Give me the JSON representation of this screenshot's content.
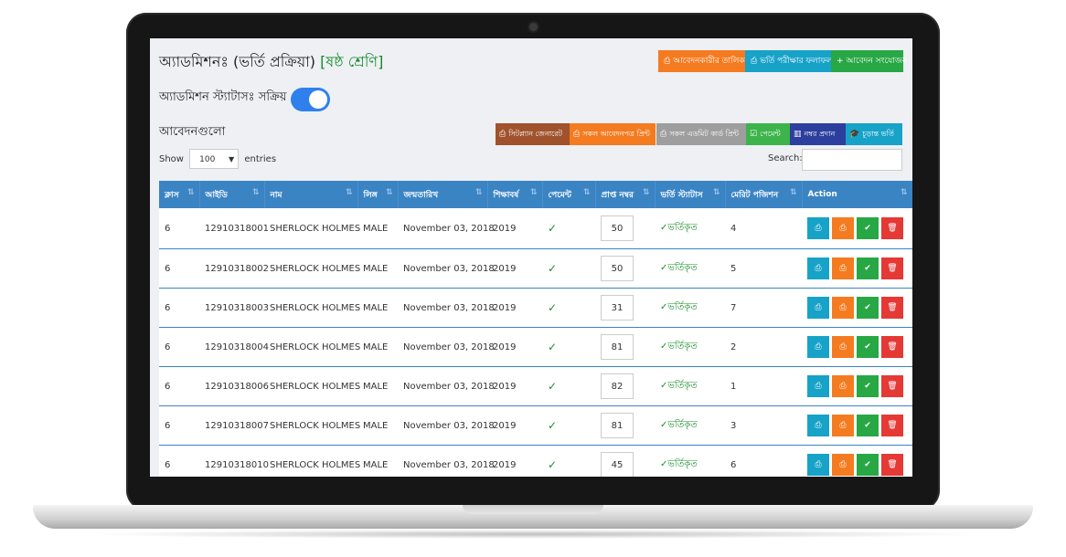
{
  "page": {
    "title": "অ্যাডমিশনঃ (ভর্তি প্রক্রিয়া)",
    "title_tag": "[ষষ্ঠ শ্রেণি]",
    "status_label": "অ্যাডমিশন স্ট্যাটাসঃ সক্রিয়",
    "applications_label": "আবেদনগুলো"
  },
  "top_buttons": [
    {
      "label": "আবেদনকারীর তালিকা",
      "color": "#f47b20",
      "icon": "print-icon"
    },
    {
      "label": "ভর্তি পরীক্ষার ফলাফল",
      "color": "#17a2c8",
      "icon": "print-icon"
    },
    {
      "label": "আবেদন সংযোজন",
      "color": "#28a745",
      "icon": "plus-icon"
    }
  ],
  "action_buttons": [
    {
      "label": "সিটপ্ল্যান জেনারেট",
      "color": "#a0522d",
      "icon": "print-icon"
    },
    {
      "label": "সকল আবেদনপত্র প্রিন্ট",
      "color": "#f47b20",
      "icon": "print-icon"
    },
    {
      "label": "সকল এডমিট কার্ড প্রিন্ট",
      "color": "#9e9e9e",
      "icon": "print-icon"
    },
    {
      "label": "পেমেন্ট",
      "color": "#3cb44b",
      "icon": "check-square-icon"
    },
    {
      "label": "নম্বর প্রদান",
      "color": "#2c3e9e",
      "icon": "chart-icon"
    },
    {
      "label": "চূড়ান্ত ভর্তি",
      "color": "#17a2c8",
      "icon": "graduation-cap-icon"
    }
  ],
  "datatable": {
    "show_label": "Show",
    "entries_value": "100",
    "entries_label": "entries",
    "search_label": "Search:"
  },
  "columns": [
    "ক্লাস",
    "আইডি",
    "নাম",
    "লিঙ্গ",
    "জন্মতারিখ",
    "শিক্ষাবর্ষ",
    "পেমেন্ট",
    "প্রাপ্ত নম্বর",
    "ভর্তি স্ট্যাটাস",
    "মেরিট পজিশন",
    "Action"
  ],
  "rows": [
    {
      "cls": "6",
      "id": "12910318001",
      "name": "SHERLOCK HOLMES",
      "gender": "MALE",
      "dob": "November 03, 2018",
      "year": "2019",
      "payment": "✓",
      "marks": "50",
      "status": "✓ভর্তিকৃত",
      "merit": "4"
    },
    {
      "cls": "6",
      "id": "12910318002",
      "name": "SHERLOCK HOLMES",
      "gender": "MALE",
      "dob": "November 03, 2018",
      "year": "2019",
      "payment": "✓",
      "marks": "50",
      "status": "✓ভর্তিকৃত",
      "merit": "5"
    },
    {
      "cls": "6",
      "id": "12910318003",
      "name": "SHERLOCK HOLMES",
      "gender": "MALE",
      "dob": "November 03, 2018",
      "year": "2019",
      "payment": "✓",
      "marks": "31",
      "status": "✓ভর্তিকৃত",
      "merit": "7"
    },
    {
      "cls": "6",
      "id": "12910318004",
      "name": "SHERLOCK HOLMES",
      "gender": "MALE",
      "dob": "November 03, 2018",
      "year": "2019",
      "payment": "✓",
      "marks": "81",
      "status": "✓ভর্তিকৃত",
      "merit": "2"
    },
    {
      "cls": "6",
      "id": "12910318006",
      "name": "SHERLOCK HOLMES",
      "gender": "MALE",
      "dob": "November 03, 2018",
      "year": "2019",
      "payment": "✓",
      "marks": "82",
      "status": "✓ভর্তিকৃত",
      "merit": "1"
    },
    {
      "cls": "6",
      "id": "12910318007",
      "name": "SHERLOCK HOLMES",
      "gender": "MALE",
      "dob": "November 03, 2018",
      "year": "2019",
      "payment": "✓",
      "marks": "81",
      "status": "✓ভর্তিকৃত",
      "merit": "3"
    },
    {
      "cls": "6",
      "id": "12910318010",
      "name": "SHERLOCK HOLMES",
      "gender": "MALE",
      "dob": "November 03, 2018",
      "year": "2019",
      "payment": "✓",
      "marks": "45",
      "status": "✓ভর্তিকৃত",
      "merit": "6"
    }
  ],
  "row_actions": [
    {
      "name": "view-button",
      "icon": "print-icon",
      "color": "#17a2c8"
    },
    {
      "name": "print-button",
      "icon": "print-icon",
      "color": "#f47b20"
    },
    {
      "name": "approve-button",
      "icon": "check-icon",
      "color": "#28a745"
    },
    {
      "name": "delete-button",
      "icon": "trash-icon",
      "color": "#e53935"
    }
  ],
  "toggle_on": true
}
